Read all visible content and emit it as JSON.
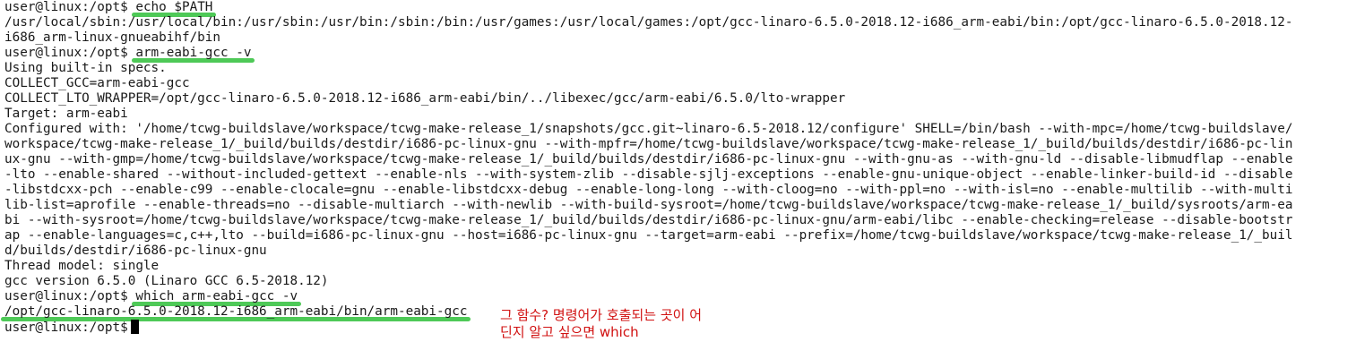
{
  "terminal": {
    "prompt": "user@linux:/opt$",
    "cmd1": "echo $PATH",
    "path_output": [
      "/usr/local/sbin:/usr/local/bin:/usr/sbin:/usr/bin:/sbin:/bin:/usr/games:/usr/local/games:/opt/gcc-linaro-6.5.0-2018.12-i686_arm-eabi/bin:/opt/gcc-linaro-6.5.0-2018.12-",
      "i686_arm-linux-gnueabihf/bin"
    ],
    "cmd2": "arm-eabi-gcc -v",
    "gcc_output": [
      "Using built-in specs.",
      "COLLECT_GCC=arm-eabi-gcc",
      "COLLECT_LTO_WRAPPER=/opt/gcc-linaro-6.5.0-2018.12-i686_arm-eabi/bin/../libexec/gcc/arm-eabi/6.5.0/lto-wrapper",
      "Target: arm-eabi",
      "Configured with: '/home/tcwg-buildslave/workspace/tcwg-make-release_1/snapshots/gcc.git~linaro-6.5-2018.12/configure' SHELL=/bin/bash --with-mpc=/home/tcwg-buildslave/",
      "workspace/tcwg-make-release_1/_build/builds/destdir/i686-pc-linux-gnu --with-mpfr=/home/tcwg-buildslave/workspace/tcwg-make-release_1/_build/builds/destdir/i686-pc-lin",
      "ux-gnu --with-gmp=/home/tcwg-buildslave/workspace/tcwg-make-release_1/_build/builds/destdir/i686-pc-linux-gnu --with-gnu-as --with-gnu-ld --disable-libmudflap --enable",
      "-lto --enable-shared --without-included-gettext --enable-nls --with-system-zlib --disable-sjlj-exceptions --enable-gnu-unique-object --enable-linker-build-id --disable",
      "-libstdcxx-pch --enable-c99 --enable-clocale=gnu --enable-libstdcxx-debug --enable-long-long --with-cloog=no --with-ppl=no --with-isl=no --enable-multilib --with-multi",
      "lib-list=aprofile --enable-threads=no --disable-multiarch --with-newlib --with-build-sysroot=/home/tcwg-buildslave/workspace/tcwg-make-release_1/_build/sysroots/arm-ea",
      "bi --with-sysroot=/home/tcwg-buildslave/workspace/tcwg-make-release_1/_build/builds/destdir/i686-pc-linux-gnu/arm-eabi/libc --enable-checking=release --disable-bootstr",
      "ap --enable-languages=c,c++,lto --build=i686-pc-linux-gnu --host=i686-pc-linux-gnu --target=arm-eabi --prefix=/home/tcwg-buildslave/workspace/tcwg-make-release_1/_buil",
      "d/builds/destdir/i686-pc-linux-gnu",
      "Thread model: single",
      "gcc version 6.5.0 (Linaro GCC 6.5-2018.12)"
    ],
    "cmd3": "which arm-eabi-gcc -v",
    "which_output": "/opt/gcc-linaro-6.5.0-2018.12-i686_arm-eabi/bin/arm-eabi-gcc"
  },
  "annotation": {
    "line1": "그 함수? 명령어가 호출되는 곳이 어",
    "line2": "딘지 알고 싶으면 which",
    "color": "#d11111"
  },
  "highlight_color": "#2fbf3a"
}
